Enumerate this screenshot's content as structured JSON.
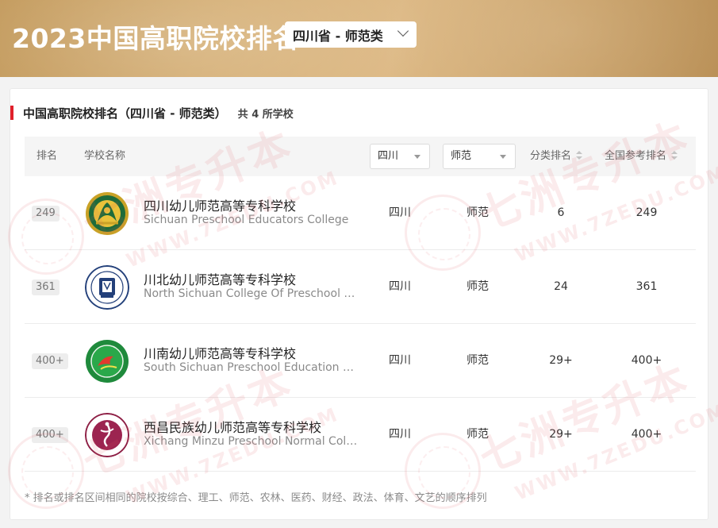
{
  "header": {
    "title": "2023中国高职院校排名",
    "region_select": "四川省 - 师范类"
  },
  "section": {
    "title": "中国高职院校排名（四川省 - 师范类）",
    "count": "共 4 所学校"
  },
  "table": {
    "columns": {
      "rank": "排名",
      "school": "学校名称",
      "province_filter": "四川",
      "category_filter": "师范",
      "category_rank": "分类排名",
      "national_rank": "全国参考排名"
    },
    "rows": [
      {
        "rank": "249",
        "name_cn": "四川幼儿师范高等专科学校",
        "name_en": "Sichuan Preschool Educators College",
        "province": "四川",
        "category": "师范",
        "category_rank": "6",
        "national_rank": "249"
      },
      {
        "rank": "361",
        "name_cn": "川北幼儿师范高等专科学校",
        "name_en": "North Sichuan College Of Preschool T...",
        "province": "四川",
        "category": "师范",
        "category_rank": "24",
        "national_rank": "361"
      },
      {
        "rank": "400+",
        "name_cn": "川南幼儿师范高等专科学校",
        "name_en": "South Sichuan Preschool Education C...",
        "province": "四川",
        "category": "师范",
        "category_rank": "29+",
        "national_rank": "400+"
      },
      {
        "rank": "400+",
        "name_cn": "西昌民族幼儿师范高等专科学校",
        "name_en": "Xichang Minzu Preschool Normal Coll...",
        "province": "四川",
        "category": "师范",
        "category_rank": "29+",
        "national_rank": "400+"
      }
    ]
  },
  "footnote": "* 排名或排名区间相同的院校按综合、理工、师范、农林、医药、财经、政法、体育、文艺的顺序排列",
  "watermark": {
    "brand": "七洲专升本",
    "url": "WWW.7ZEDU.COM"
  },
  "colors": {
    "banner": "#d4ad72",
    "accent": "#e0202a"
  }
}
